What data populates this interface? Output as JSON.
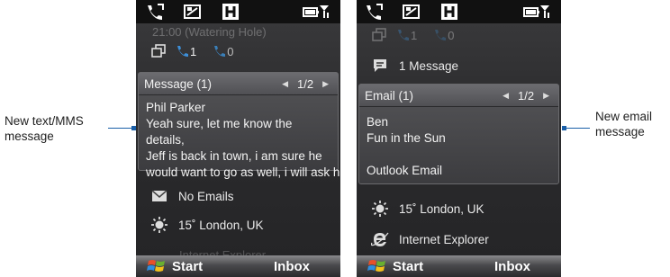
{
  "callouts": {
    "left_line1": "New text/MMS",
    "left_line2": "message",
    "right_line1": "New email",
    "right_line2": "message"
  },
  "phone1": {
    "ghost_text": "21:00 (Watering Hole)",
    "missed_calls": "1",
    "voicemail": "0",
    "panel": {
      "title": "Message (1)",
      "pager": "1/2",
      "sender": "Phil Parker",
      "line1": "Yeah sure, let me know the details,",
      "line2": "Jeff is back in town, i am sure he",
      "line3": "would want to go as well, i will ask him"
    },
    "email_row": "No Emails",
    "weather_row": "15˚ London, UK",
    "ghost_bottom": "Internet Explorer",
    "softkey_left": "Start",
    "softkey_right": "Inbox"
  },
  "phone2": {
    "missed_calls": "1",
    "voicemail": "0",
    "message_row": "1 Message",
    "panel": {
      "title": "Email (1)",
      "pager": "1/2",
      "sender": "Ben",
      "subject": "Fun in the Sun",
      "account": "Outlook Email"
    },
    "weather_row": "15˚ London, UK",
    "ie_row": "Internet Explorer",
    "softkey_left": "Start",
    "softkey_right": "Inbox"
  },
  "colors": {
    "callout_line": "#1a5fa8",
    "screen_bg": "#2c2c2e",
    "status_bar": "#111111"
  }
}
